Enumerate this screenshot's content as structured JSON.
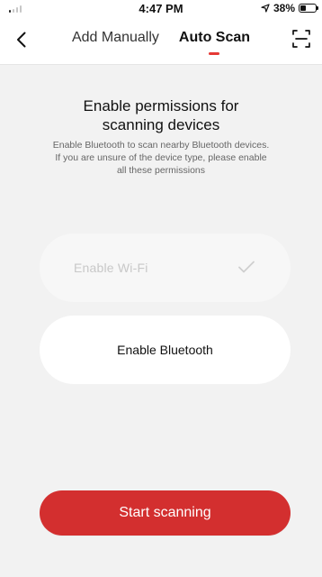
{
  "theme": {
    "accent": "#d32f2f",
    "tab_indicator": "#e53935"
  },
  "status_bar": {
    "time": "4:47 PM",
    "battery": "38%",
    "battery_level": 0.38,
    "icons": [
      "signal-icon",
      "location-arrow-icon",
      "battery-icon"
    ]
  },
  "nav": {
    "back_icon": "chevron-left-icon",
    "tabs": [
      {
        "label": "Add Manually"
      },
      {
        "label": "Auto Scan",
        "active": true
      }
    ],
    "scan_icon": "scan-frame-icon"
  },
  "main": {
    "title_line1": "Enable permissions for",
    "title_line2": "scanning devices",
    "subtitle_line1": "Enable Bluetooth to scan nearby Bluetooth devices.",
    "subtitle_line2": "If you are unsure of the device type, please enable",
    "subtitle_line3": "all these permissions",
    "permissions": [
      {
        "label": "Enable Wi-Fi",
        "enabled": true,
        "icon": "check-icon"
      },
      {
        "label": "Enable Bluetooth",
        "enabled": false
      }
    ],
    "start_button": "Start scanning"
  }
}
